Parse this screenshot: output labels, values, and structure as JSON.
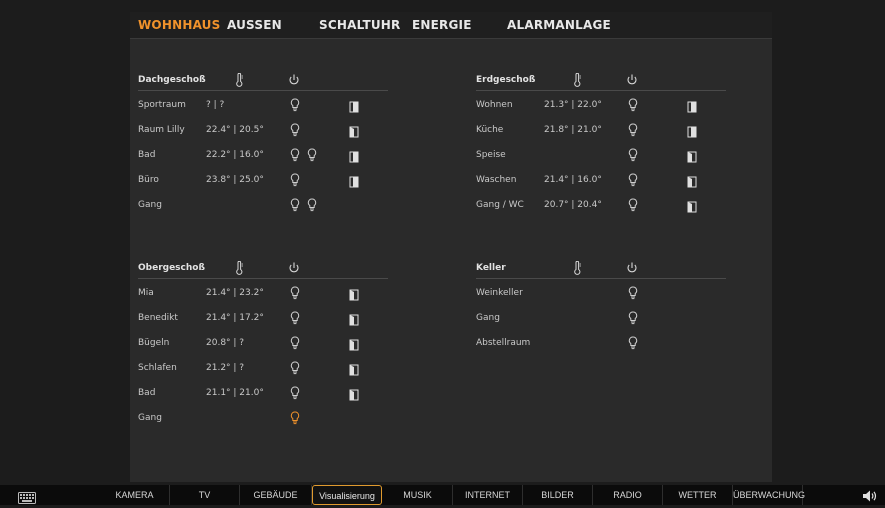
{
  "top_tabs": [
    {
      "label": "WOHNHAUS",
      "active": true
    },
    {
      "label": "AUSSEN",
      "active": false
    },
    {
      "label": "SCHALTUHR",
      "active": false
    },
    {
      "label": "ENERGIE",
      "active": false
    },
    {
      "label": "ALARMANLAGE",
      "active": false
    }
  ],
  "sections": {
    "dachgeschoss": {
      "title": "Dachgeschoß",
      "rooms": [
        {
          "name": "Sportraum",
          "temp": "?    | ?",
          "bulbs": 1,
          "bulb_on": [
            false
          ],
          "shutter": "closed"
        },
        {
          "name": "Raum Lilly",
          "temp": "22.4°  | 20.5°",
          "bulbs": 1,
          "bulb_on": [
            false
          ],
          "shutter": "open"
        },
        {
          "name": "Bad",
          "temp": "22.2°  | 16.0°",
          "bulbs": 2,
          "bulb_on": [
            false,
            false
          ],
          "shutter": "closed"
        },
        {
          "name": "Büro",
          "temp": "23.8°  | 25.0°",
          "bulbs": 1,
          "bulb_on": [
            false
          ],
          "shutter": "closed"
        },
        {
          "name": "Gang",
          "temp": "",
          "bulbs": 2,
          "bulb_on": [
            false,
            false
          ],
          "shutter": ""
        }
      ]
    },
    "erdgeschoss": {
      "title": "Erdgeschoß",
      "rooms": [
        {
          "name": "Wohnen",
          "temp": "21.3°  | 22.0°",
          "bulbs": 1,
          "bulb_on": [
            false
          ],
          "shutter": "closed"
        },
        {
          "name": "Küche",
          "temp": "21.8°  | 21.0°",
          "bulbs": 1,
          "bulb_on": [
            false
          ],
          "shutter": "closed"
        },
        {
          "name": "Speise",
          "temp": "",
          "bulbs": 1,
          "bulb_on": [
            false
          ],
          "shutter": "open"
        },
        {
          "name": "Waschen",
          "temp": "21.4°  | 16.0°",
          "bulbs": 1,
          "bulb_on": [
            false
          ],
          "shutter": "open"
        },
        {
          "name": "Gang / WC",
          "temp": "20.7°  | 20.4°",
          "bulbs": 1,
          "bulb_on": [
            false
          ],
          "shutter": "open"
        }
      ]
    },
    "obergeschoss": {
      "title": "Obergeschoß",
      "rooms": [
        {
          "name": "Mia",
          "temp": "21.4°  | 23.2°",
          "bulbs": 1,
          "bulb_on": [
            false
          ],
          "shutter": "open"
        },
        {
          "name": "Benedikt",
          "temp": "21.4°  | 17.2°",
          "bulbs": 1,
          "bulb_on": [
            false
          ],
          "shutter": "open"
        },
        {
          "name": "Bügeln",
          "temp": "20.8°  | ?",
          "bulbs": 1,
          "bulb_on": [
            false
          ],
          "shutter": "open"
        },
        {
          "name": "Schlafen",
          "temp": "21.2°  | ?",
          "bulbs": 1,
          "bulb_on": [
            false
          ],
          "shutter": "open"
        },
        {
          "name": "Bad",
          "temp": "21.1°  | 21.0°",
          "bulbs": 1,
          "bulb_on": [
            false
          ],
          "shutter": "open"
        },
        {
          "name": "Gang",
          "temp": "",
          "bulbs": 1,
          "bulb_on": [
            true
          ],
          "shutter": ""
        }
      ]
    },
    "keller": {
      "title": "Keller",
      "rooms": [
        {
          "name": "Weinkeller",
          "temp": "",
          "bulbs": 1,
          "bulb_on": [
            false
          ],
          "shutter": ""
        },
        {
          "name": "Gang",
          "temp": "",
          "bulbs": 1,
          "bulb_on": [
            false
          ],
          "shutter": ""
        },
        {
          "name": "Abstellraum",
          "temp": "",
          "bulbs": 1,
          "bulb_on": [
            false
          ],
          "shutter": ""
        }
      ]
    }
  },
  "bottom_tabs": [
    {
      "label": "KAMERA",
      "active": false
    },
    {
      "label": "TV",
      "active": false
    },
    {
      "label": "GEBÄUDE",
      "active": false
    },
    {
      "label": "Visualisierung",
      "active": true
    },
    {
      "label": "MUSIK",
      "active": false
    },
    {
      "label": "INTERNET",
      "active": false
    },
    {
      "label": "BILDER",
      "active": false
    },
    {
      "label": "RADIO",
      "active": false
    },
    {
      "label": "WETTER",
      "active": false
    },
    {
      "label": "ÜBERWACHUNG",
      "active": false
    }
  ],
  "colors": {
    "accent": "#f0922b",
    "bulb_off": "#d0d0d0",
    "bulb_on": "#f0922b",
    "background": "#2a2a2a"
  },
  "icons": {
    "temperature": "thermometer-icon",
    "power": "power-icon",
    "light": "lightbulb-icon",
    "shutter": "shutter-icon",
    "keyboard": "keyboard-icon",
    "speaker": "speaker-icon"
  }
}
